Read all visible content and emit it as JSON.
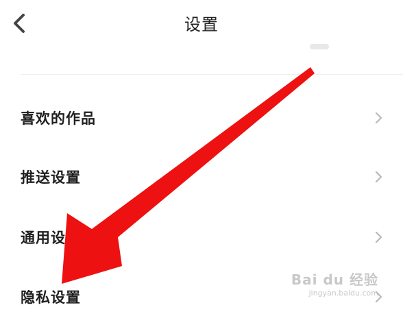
{
  "header": {
    "title": "设置"
  },
  "menu": {
    "items": [
      {
        "label": "喜欢的作品"
      },
      {
        "label": "推送设置"
      },
      {
        "label": "通用设置"
      },
      {
        "label": "隐私设置"
      }
    ]
  },
  "watermark": {
    "main": "Bai du 经验",
    "sub": "jingyan.baidu.com"
  },
  "colors": {
    "annotation_arrow": "#ee1111",
    "chevron": "#b8b8b8",
    "back_icon": "#444444"
  }
}
